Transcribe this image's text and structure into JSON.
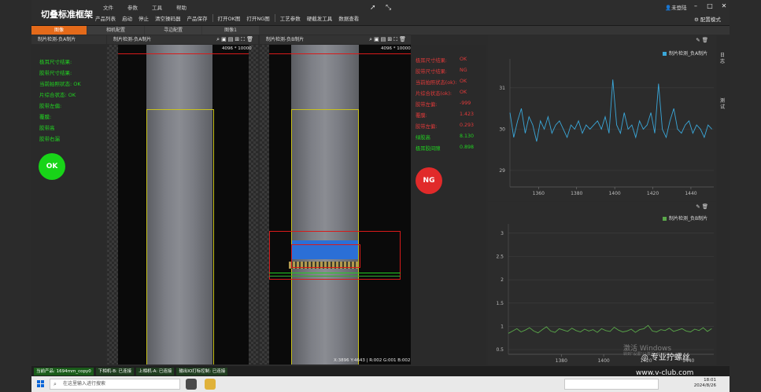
{
  "app": {
    "title": "切叠标准框架",
    "menus": [
      "文件",
      "参数",
      "工具",
      "帮助"
    ],
    "toolbar": [
      "产品列表",
      "启动",
      "停止",
      "清空操码器",
      "产品保存",
      "打开OK图",
      "打开NG图",
      "工艺参数",
      "硬截发工具",
      "数据查看"
    ],
    "user": "未登陆",
    "config_mode": "配置模式"
  },
  "tabs": [
    {
      "label": "图像",
      "active": true
    },
    {
      "label": "相机配置",
      "active": false
    },
    {
      "label": "寻边配置",
      "active": false
    },
    {
      "label": "图像1",
      "active": false
    }
  ],
  "left": {
    "header": "制片检测-负A制片",
    "lines": [
      "极耳尺寸结果:",
      "胶带尺寸结果:",
      "当前拍照状态: OK",
      "片综合状态:   OK",
      "胶带左偏:",
      "覆膜:",
      "胶带高",
      "胶带右漏"
    ],
    "badge": "OK"
  },
  "imageA": {
    "header": "制片检测-负A制片",
    "resolution": "4096 * 10000"
  },
  "imageB": {
    "header": "制片检测-负B制片",
    "resolution": "4096 * 10000",
    "coords": "X:3896  Y:4643  |  R:002  G:001  B:002"
  },
  "results": {
    "rows": [
      {
        "k": "极耳尺寸结果:",
        "v": "OK",
        "color": "#e23a3a"
      },
      {
        "k": "胶带尺寸结果:",
        "v": "NG",
        "color": "#e23a3a"
      },
      {
        "k": "当前拍照状态(ok):",
        "v": "OK",
        "color": "#e23a3a"
      },
      {
        "k": "片综合状态(ok):",
        "v": "OK",
        "color": "#e23a3a"
      },
      {
        "k": "胶带左偏:",
        "v": "-999",
        "color": "#e23a3a"
      },
      {
        "k": "覆膜:",
        "v": "1.423",
        "color": "#e23a3a"
      },
      {
        "k": "胶带左偏:",
        "v": "0.293",
        "color": "#e23a3a"
      },
      {
        "k": "绿胶高",
        "v": "8.130",
        "color": "#21d321"
      },
      {
        "k": "极耳胶间隙",
        "v": "0.898",
        "color": "#21d321"
      }
    ],
    "badge": "NG"
  },
  "side_tabs": [
    "日志",
    "测试"
  ],
  "status": [
    "当前产品: 1694mm_copy0",
    "下相机-B: 已连接",
    "上相机-A: 已连接",
    "输出IO打标控制: 已连接"
  ],
  "taskbar": {
    "search_placeholder": "在这里输入进行搜索",
    "time": "18:01",
    "date": "2024/8/26"
  },
  "watermark": {
    "line1": "激活 Windows",
    "line2": "转到\"设置\"以激活 Windows。"
  },
  "brand": {
    "name": "专业拧螺丝",
    "url": "www.v-club.com"
  },
  "colors": {
    "accent": "#e46a1a",
    "ok": "#18d418",
    "ng": "#e12a2a",
    "series1": "#3aa7d9",
    "series2": "#5aa84a"
  },
  "chart_data": [
    {
      "type": "line",
      "series": [
        {
          "name": "制片检测_负A制片",
          "color": "#3aa7d9",
          "x": [
            1345,
            1347,
            1349,
            1351,
            1353,
            1355,
            1357,
            1359,
            1361,
            1363,
            1365,
            1367,
            1369,
            1371,
            1373,
            1375,
            1377,
            1379,
            1381,
            1383,
            1385,
            1387,
            1389,
            1391,
            1393,
            1395,
            1397,
            1399,
            1401,
            1403,
            1405,
            1407,
            1409,
            1411,
            1413,
            1415,
            1417,
            1419,
            1421,
            1423,
            1425,
            1427,
            1429,
            1431,
            1433,
            1435,
            1437,
            1439,
            1441,
            1443,
            1445,
            1447,
            1449,
            1451
          ],
          "y": [
            30.4,
            29.8,
            30.2,
            30.5,
            29.9,
            30.3,
            30.1,
            29.7,
            30.2,
            30.0,
            30.3,
            29.9,
            30.1,
            30.2,
            30.0,
            29.8,
            30.1,
            30.0,
            30.2,
            29.9,
            30.1,
            30.0,
            30.1,
            30.2,
            30.0,
            30.3,
            29.9,
            31.2,
            30.1,
            29.9,
            30.4,
            30.0,
            30.1,
            29.8,
            30.2,
            30.0,
            30.1,
            30.4,
            29.9,
            31.1,
            30.0,
            29.8,
            30.2,
            30.5,
            30.0,
            29.9,
            30.1,
            30.2,
            29.9,
            30.1,
            30.0,
            29.8,
            30.1,
            30.0
          ]
        }
      ],
      "xticks": [
        1360,
        1380,
        1400,
        1420,
        1440
      ],
      "yticks": [
        29,
        30,
        31
      ],
      "xlim": [
        1345,
        1452
      ],
      "ylim": [
        28.6,
        31.7
      ]
    },
    {
      "type": "line",
      "series": [
        {
          "name": "制片检测_负B制片",
          "color": "#5aa84a",
          "x": [
            1355,
            1357,
            1359,
            1361,
            1363,
            1365,
            1367,
            1369,
            1371,
            1373,
            1375,
            1377,
            1379,
            1381,
            1383,
            1385,
            1387,
            1389,
            1391,
            1393,
            1395,
            1397,
            1399,
            1401,
            1403,
            1405,
            1407,
            1409,
            1411,
            1413,
            1415,
            1417,
            1419,
            1421,
            1423,
            1425,
            1427,
            1429,
            1431,
            1433,
            1435,
            1437,
            1439,
            1441,
            1443,
            1445,
            1447,
            1449,
            1451
          ],
          "y": [
            0.85,
            0.9,
            0.95,
            0.88,
            0.92,
            0.97,
            0.9,
            0.86,
            0.93,
            0.99,
            0.9,
            0.87,
            0.95,
            0.92,
            0.89,
            0.96,
            0.91,
            0.88,
            0.94,
            0.9,
            0.93,
            0.87,
            0.95,
            0.91,
            0.89,
            0.98,
            0.92,
            0.88,
            0.9,
            0.94,
            0.87,
            0.93,
            0.95,
            1.02,
            0.9,
            0.88,
            0.93,
            0.91,
            0.96,
            0.89,
            0.92,
            0.95,
            0.9,
            0.88,
            0.94,
            0.91,
            0.97,
            0.89,
            0.95
          ]
        }
      ],
      "xticks": [
        1380,
        1400,
        1420,
        1440
      ],
      "yticks": [
        0.5,
        1,
        1.5,
        2,
        2.5,
        3
      ],
      "xlim": [
        1355,
        1452
      ],
      "ylim": [
        0.4,
        3.2
      ]
    }
  ]
}
